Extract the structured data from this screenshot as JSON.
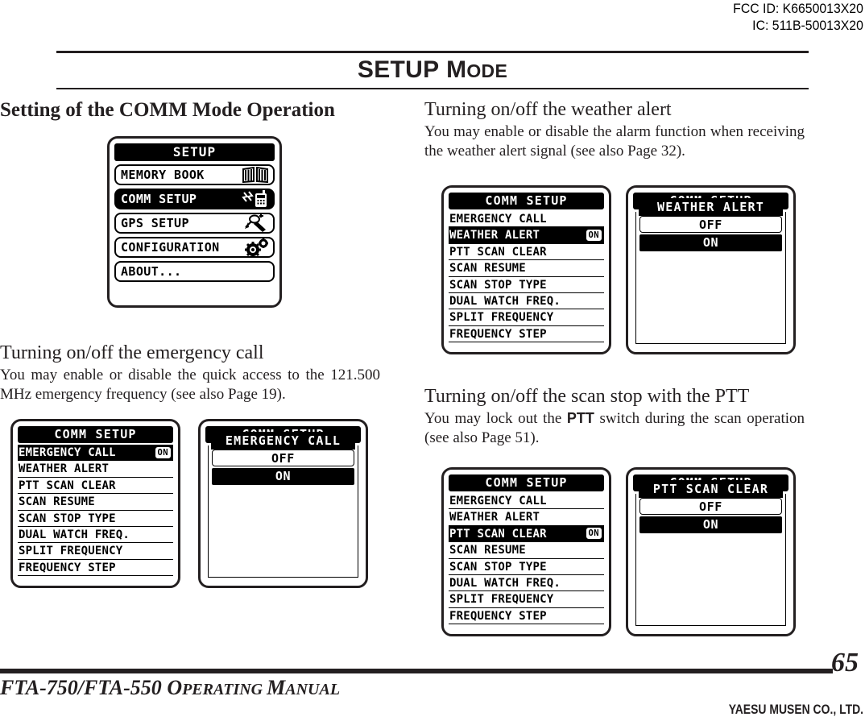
{
  "header": {
    "fcc_id": "FCC ID: K6650013X20",
    "ic_id": "IC: 511B-50013X20"
  },
  "title": {
    "main": "SETUP",
    "small_caps_first": "M",
    "small_caps_rest": "ODE"
  },
  "left_column": {
    "section_heading": "Setting of the COMM Mode Operation",
    "subsection": {
      "heading": "Turning on/off the emergency call",
      "body": "You may enable or disable the quick access to the 121.500 MHz emergency frequency (see also Page 19)."
    }
  },
  "right_column": {
    "weather": {
      "heading": "Turning on/off the weather alert",
      "body": "You may enable or disable the alarm function when receiving the weather alert signal (see also Page 32)."
    },
    "ptt": {
      "heading": "Turning on/off the scan stop with the PTT",
      "body_before": "You may lock out the ",
      "body_bold": "PTT",
      "body_after": " switch during the scan operation (see also Page 51)."
    }
  },
  "setup_screen": {
    "title": "SETUP",
    "items": [
      {
        "label": "MEMORY BOOK",
        "icon": "book-icon",
        "selected": false
      },
      {
        "label": "COMM SETUP",
        "icon": "handheld-radio-icon",
        "selected": true
      },
      {
        "label": "GPS SETUP",
        "icon": "satellite-icon",
        "selected": false
      },
      {
        "label": "CONFIGURATION",
        "icon": "gears-icon",
        "selected": false
      },
      {
        "label": "ABOUT...",
        "icon": "none",
        "selected": false
      }
    ]
  },
  "comm_setup": {
    "title": "COMM SETUP",
    "menu_items": [
      "EMERGENCY CALL",
      "WEATHER ALERT",
      "PTT SCAN CLEAR",
      "SCAN RESUME",
      "SCAN STOP TYPE",
      "DUAL WATCH FREQ.",
      "SPLIT FREQUENCY",
      "FREQUENCY STEP"
    ],
    "badge_value": "ON",
    "options": [
      "OFF",
      "ON"
    ],
    "selected_option": "ON"
  },
  "screens": {
    "emergency": {
      "selected_index": 0,
      "sub_title": "EMERGENCY CALL"
    },
    "weather": {
      "selected_index": 1,
      "sub_title": "WEATHER ALERT"
    },
    "ptt": {
      "selected_index": 2,
      "sub_title": "PTT SCAN CLEAR"
    }
  },
  "footer": {
    "manual_model": "FTA-750/FTA-550 ",
    "manual_o": "O",
    "manual_perating": "PERATING ",
    "manual_m": "M",
    "manual_anual": "ANUAL",
    "page_number": "65",
    "company": "YAESU MUSEN CO., LTD."
  },
  "colors": {
    "ink": "#231f20",
    "paper": "#ffffff"
  }
}
